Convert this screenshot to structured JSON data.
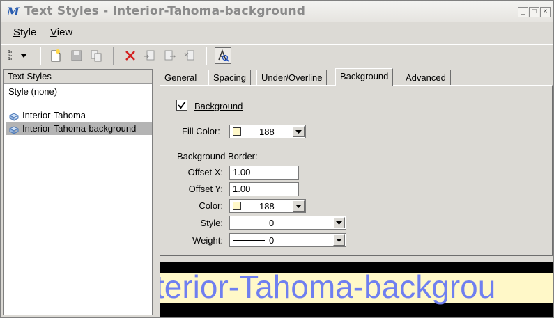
{
  "window": {
    "title": "Text Styles - Interior-Tahoma-background",
    "app_icon_glyph": "M",
    "buttons": {
      "minimize": "_",
      "maximize": "□",
      "close": "×"
    }
  },
  "menu": {
    "style": {
      "label": "Style",
      "mnemonic_index": 0
    },
    "view": {
      "label": "View",
      "mnemonic_index": 0
    }
  },
  "toolbar": {
    "icons": [
      "tree-view-icon",
      "dropdown-arrow-icon",
      "new-icon",
      "save-icon",
      "copy-icon",
      "delete-icon",
      "import-icon",
      "export-icon",
      "reset-icon",
      "text-preview-icon"
    ]
  },
  "left_panel": {
    "header": "Text Styles",
    "none_item": "Style (none)",
    "styles": [
      {
        "label": "Interior-Tahoma",
        "selected": false
      },
      {
        "label": "Interior-Tahoma-background",
        "selected": true
      }
    ]
  },
  "tabs": [
    {
      "label": "General",
      "active": false
    },
    {
      "label": "Spacing",
      "active": false
    },
    {
      "label": "Under/Overline",
      "active": false
    },
    {
      "label": "Background",
      "active": true
    },
    {
      "label": "Advanced",
      "active": false
    }
  ],
  "background_tab": {
    "background_checkbox": {
      "label": "Background",
      "checked": true
    },
    "fill_color": {
      "label": "Fill Color:",
      "value": "188",
      "swatch": "#fff8c8"
    },
    "border_section_label": "Background Border:",
    "offset_x": {
      "label": "Offset X:",
      "value": "1.00"
    },
    "offset_y": {
      "label": "Offset Y:",
      "value": "1.00"
    },
    "color": {
      "label": "Color:",
      "value": "188",
      "swatch": "#fff8c8"
    },
    "style": {
      "label": "Style:",
      "value": "0"
    },
    "weight": {
      "label": "Weight:",
      "value": "0"
    }
  },
  "preview": {
    "text": "terior-Tahoma-backgrou",
    "text_color": "#6f7ff0",
    "background_color": "#fff8c8",
    "border_color": "#000000"
  }
}
